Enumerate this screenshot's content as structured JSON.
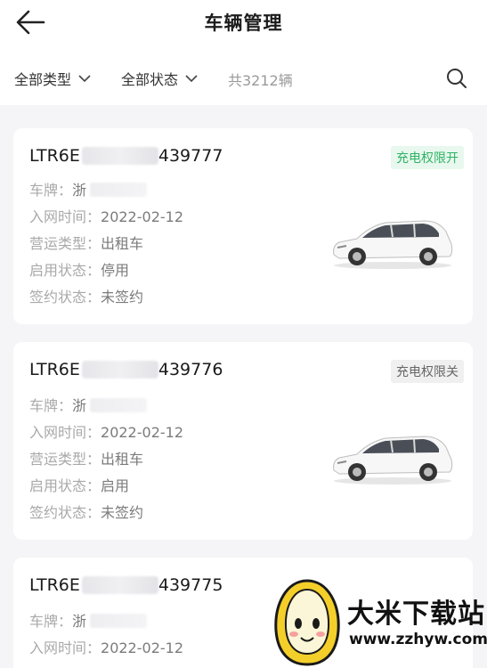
{
  "header": {
    "title": "车辆管理"
  },
  "filters": {
    "type_label": "全部类型",
    "status_label": "全部状态",
    "count_text": "共3212辆"
  },
  "labels": {
    "plate": "车牌：",
    "joined": "入网时间：",
    "op_type": "营运类型：",
    "enable": "启用状态：",
    "sign": "签约状态："
  },
  "vehicles": [
    {
      "vin_prefix": "LTR6E",
      "vin_suffix": "439777",
      "badge": "充电权限开",
      "badge_state": "on",
      "plate": "浙",
      "joined": "2022-02-12",
      "op_type": "出租车",
      "enable": "停用",
      "sign": "未签约"
    },
    {
      "vin_prefix": "LTR6E",
      "vin_suffix": "439776",
      "badge": "充电权限关",
      "badge_state": "off",
      "plate": "浙",
      "joined": "2022-02-12",
      "op_type": "出租车",
      "enable": "启用",
      "sign": "未签约"
    },
    {
      "vin_prefix": "LTR6E",
      "vin_suffix": "439775",
      "plate": "浙",
      "joined": "2022-02-12"
    }
  ],
  "watermark": {
    "name": "大米下载站",
    "url": "www.zzhyw.com"
  },
  "colors": {
    "badge_on_bg": "#e8f8ee",
    "badge_on_fg": "#2fb365",
    "badge_off_bg": "#f0f0f0",
    "badge_off_fg": "#666666"
  },
  "icons": {
    "back": "back-arrow-icon",
    "chevron": "chevron-down-icon",
    "search": "search-icon",
    "car": "car-image",
    "mascot": "rice-mascot-logo"
  }
}
